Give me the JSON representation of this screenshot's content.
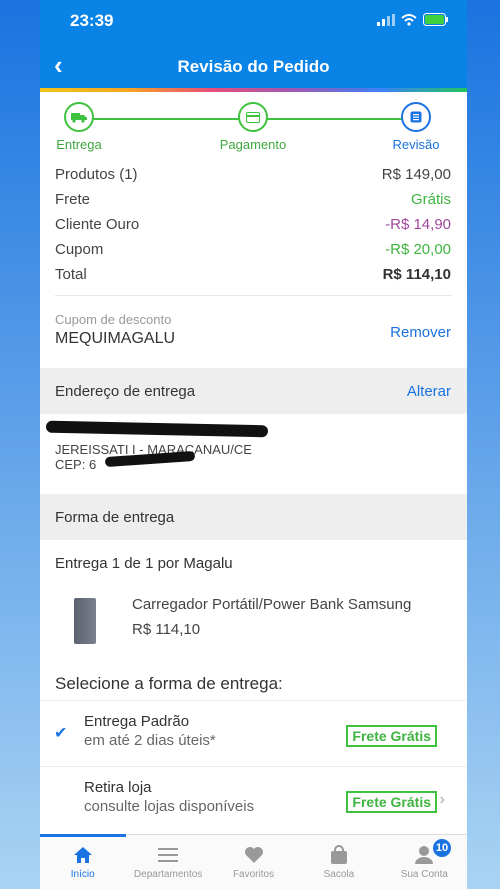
{
  "status": {
    "time": "23:39"
  },
  "header": {
    "title": "Revisão do Pedido"
  },
  "steps": [
    {
      "label": "Entrega",
      "icon": "truck-icon"
    },
    {
      "label": "Pagamento",
      "icon": "card-icon"
    },
    {
      "label": "Revisão",
      "icon": "list-icon"
    }
  ],
  "summary": {
    "products_label": "Produtos (1)",
    "products_value": "R$ 149,00",
    "shipping_label": "Frete",
    "shipping_value": "Grátis",
    "gold_label": "Cliente Ouro",
    "gold_value": "-R$ 14,90",
    "coupon_label": "Cupom",
    "coupon_value": "-R$ 20,00",
    "total_label": "Total",
    "total_value": "R$ 114,10"
  },
  "coupon": {
    "label": "Cupom de desconto",
    "code": "MEQUIMAGALU",
    "remove": "Remover"
  },
  "address": {
    "title": "Endereço de entrega",
    "change": "Alterar",
    "line1": "JEREISSATI I - MARACANAU/CE",
    "line2": "CEP: 6"
  },
  "delivery": {
    "title": "Forma de entrega",
    "line": "Entrega 1 de 1 por Magalu",
    "product_name": "Carregador Portátil/Power Bank Samsung",
    "product_price": "R$ 114,10",
    "select_title": "Selecione a forma de entrega:",
    "options": [
      {
        "name": "Entrega Padrão",
        "desc": "em até 2 dias úteis*",
        "badge": "Frete Grátis"
      },
      {
        "name": "Retira loja",
        "desc": "consulte lojas disponíveis",
        "badge": "Frete Grátis"
      }
    ]
  },
  "tabs": [
    {
      "label": "Início"
    },
    {
      "label": "Departamentos"
    },
    {
      "label": "Favoritos"
    },
    {
      "label": "Sacola"
    },
    {
      "label": "Sua Conta",
      "badge": "10"
    }
  ],
  "colors": {
    "primary": "#0a83e6",
    "green": "#3fb43f",
    "purple": "#a0479d"
  }
}
